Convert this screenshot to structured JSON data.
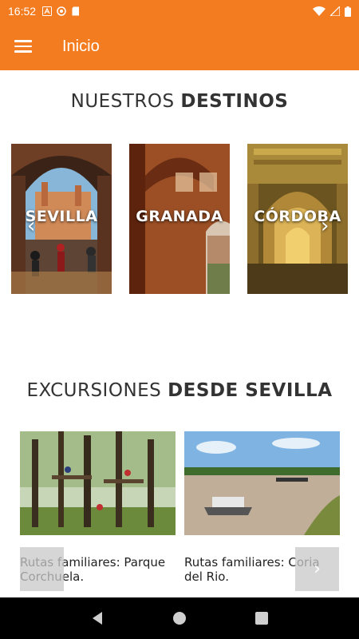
{
  "status_bar": {
    "time": "16:52"
  },
  "app_bar": {
    "title": "Inicio"
  },
  "destinations_section": {
    "title_light": "NUESTROS ",
    "title_bold": "DESTINOS",
    "cards": [
      {
        "label": "SEVILLA"
      },
      {
        "label": "GRANADA"
      },
      {
        "label": "CÓRDOBA"
      }
    ],
    "prev_arrow": "‹",
    "next_arrow": "›"
  },
  "excursions_section": {
    "title_light": "EXCURSIONES ",
    "title_bold": "DESDE SEVILLA",
    "cards": [
      {
        "title": "Rutas familiares: Parque Corchuela."
      },
      {
        "title": "Rutas familiares: Coria del Rio."
      }
    ],
    "next_arrow": "›"
  },
  "colors": {
    "primary": "#f47c20",
    "nav_bar": "#000000"
  }
}
